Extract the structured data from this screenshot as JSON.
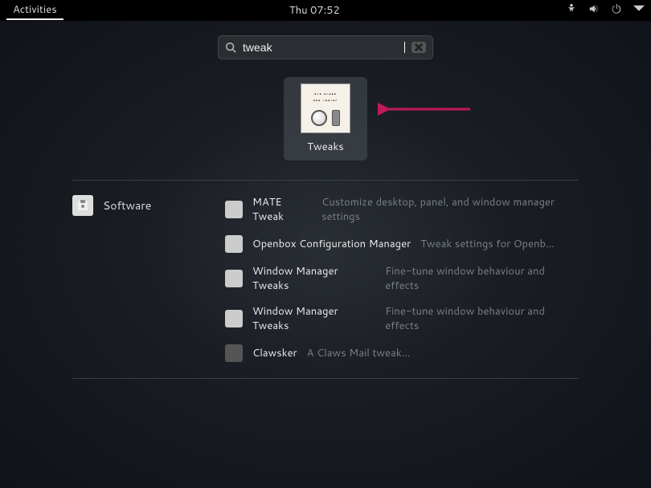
{
  "topbar": {
    "activities": "Activities",
    "clock": "Thu 07:52"
  },
  "search": {
    "value": "tweak"
  },
  "app_result": {
    "label": "Tweaks"
  },
  "software": {
    "provider_label": "Software",
    "items": [
      {
        "name": "MATE Tweak",
        "desc": "Customize desktop, panel, and window manager settings"
      },
      {
        "name": "Openbox Configuration Manager",
        "desc": "Tweak settings for Openb..."
      },
      {
        "name": "Window Manager Tweaks",
        "desc": "Fine-tune window behaviour and effects"
      },
      {
        "name": "Window Manager Tweaks",
        "desc": "Fine-tune window behaviour and effects"
      },
      {
        "name": "Clawsker",
        "desc": "A Claws Mail tweak..."
      }
    ]
  }
}
